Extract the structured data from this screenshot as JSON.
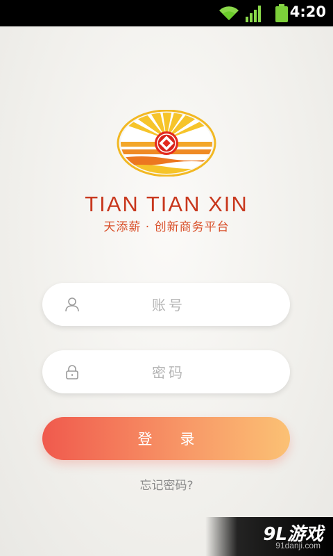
{
  "status_bar": {
    "time": "4:20",
    "icons": [
      "wifi-icon",
      "signal-icon",
      "battery-icon"
    ]
  },
  "brand": {
    "name_en": "TIAN TIAN XIN",
    "tagline_cn": "天添薪 · 创新商务平台"
  },
  "form": {
    "account_placeholder": "账号",
    "password_placeholder": "密码",
    "login_label": "登录",
    "forgot_label": "忘记密码?"
  },
  "watermark": {
    "text": "9L游戏",
    "url": "91danji.com"
  },
  "colors": {
    "brand_red": "#c8371d",
    "button_start": "#f05a4d",
    "button_end": "#fbc174",
    "logo_yellow": "#f6c42a",
    "logo_orange": "#ef7b1f"
  }
}
